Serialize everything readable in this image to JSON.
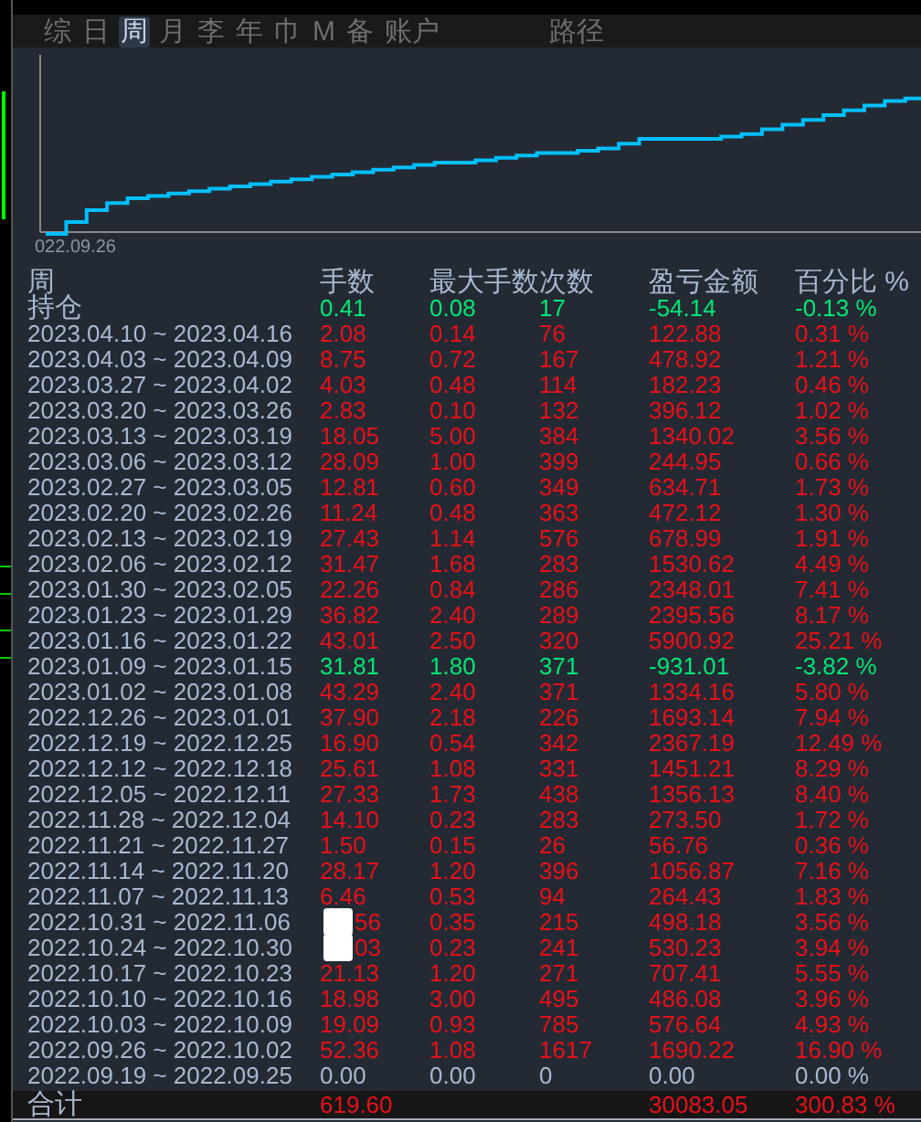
{
  "tabs": [
    {
      "label": "综",
      "selected": false
    },
    {
      "label": "日",
      "selected": false
    },
    {
      "label": "周",
      "selected": true
    },
    {
      "label": "月",
      "selected": false
    },
    {
      "label": "李",
      "selected": false
    },
    {
      "label": "年",
      "selected": false
    },
    {
      "label": "巾",
      "selected": false
    },
    {
      "label": "M",
      "selected": false
    },
    {
      "label": "备",
      "selected": false
    },
    {
      "label": "账户",
      "selected": false
    },
    {
      "label": "路径",
      "selected": false
    }
  ],
  "chart": {
    "x_label": "022.09.26"
  },
  "table": {
    "columns": [
      "周",
      "手数",
      "最大手数",
      "次数",
      "盈亏金额",
      "百分比 %"
    ],
    "holding": {
      "cells": [
        "持仓",
        "0.41",
        "0.08",
        "17",
        "-54.14",
        "-0.13 %"
      ],
      "color": "#00e676"
    },
    "rows": [
      {
        "cells": [
          "2023.04.10 ~ 2023.04.16",
          "2.08",
          "0.14",
          "76",
          "122.88",
          "0.31 %"
        ],
        "color": "#e8101a"
      },
      {
        "cells": [
          "2023.04.03 ~ 2023.04.09",
          "8.75",
          "0.72",
          "167",
          "478.92",
          "1.21 %"
        ],
        "color": "#e8101a"
      },
      {
        "cells": [
          "2023.03.27 ~ 2023.04.02",
          "4.03",
          "0.48",
          "114",
          "182.23",
          "0.46 %"
        ],
        "color": "#e8101a"
      },
      {
        "cells": [
          "2023.03.20 ~ 2023.03.26",
          "2.83",
          "0.10",
          "132",
          "396.12",
          "1.02 %"
        ],
        "color": "#e8101a"
      },
      {
        "cells": [
          "2023.03.13 ~ 2023.03.19",
          "18.05",
          "5.00",
          "384",
          "1340.02",
          "3.56 %"
        ],
        "color": "#e8101a"
      },
      {
        "cells": [
          "2023.03.06 ~ 2023.03.12",
          "28.09",
          "1.00",
          "399",
          "244.95",
          "0.66 %"
        ],
        "color": "#e8101a"
      },
      {
        "cells": [
          "2023.02.27 ~ 2023.03.05",
          "12.81",
          "0.60",
          "349",
          "634.71",
          "1.73 %"
        ],
        "color": "#e8101a"
      },
      {
        "cells": [
          "2023.02.20 ~ 2023.02.26",
          "11.24",
          "0.48",
          "363",
          "472.12",
          "1.30 %"
        ],
        "color": "#e8101a"
      },
      {
        "cells": [
          "2023.02.13 ~ 2023.02.19",
          "27.43",
          "1.14",
          "576",
          "678.99",
          "1.91 %"
        ],
        "color": "#e8101a"
      },
      {
        "cells": [
          "2023.02.06 ~ 2023.02.12",
          "31.47",
          "1.68",
          "283",
          "1530.62",
          "4.49 %"
        ],
        "color": "#e8101a"
      },
      {
        "cells": [
          "2023.01.30 ~ 2023.02.05",
          "22.26",
          "0.84",
          "286",
          "2348.01",
          "7.41 %"
        ],
        "color": "#e8101a"
      },
      {
        "cells": [
          "2023.01.23 ~ 2023.01.29",
          "36.82",
          "2.40",
          "289",
          "2395.56",
          "8.17 %"
        ],
        "color": "#e8101a"
      },
      {
        "cells": [
          "2023.01.16 ~ 2023.01.22",
          "43.01",
          "2.50",
          "320",
          "5900.92",
          "25.21 %"
        ],
        "color": "#e8101a"
      },
      {
        "cells": [
          "2023.01.09 ~ 2023.01.15",
          "31.81",
          "1.80",
          "371",
          "-931.01",
          "-3.82 %"
        ],
        "color": "#00e676"
      },
      {
        "cells": [
          "2023.01.02 ~ 2023.01.08",
          "43.29",
          "2.40",
          "371",
          "1334.16",
          "5.80 %"
        ],
        "color": "#e8101a"
      },
      {
        "cells": [
          "2022.12.26 ~ 2023.01.01",
          "37.90",
          "2.18",
          "226",
          "1693.14",
          "7.94 %"
        ],
        "color": "#e8101a"
      },
      {
        "cells": [
          "2022.12.19 ~ 2022.12.25",
          "16.90",
          "0.54",
          "342",
          "2367.19",
          "12.49 %"
        ],
        "color": "#e8101a"
      },
      {
        "cells": [
          "2022.12.12 ~ 2022.12.18",
          "25.61",
          "1.08",
          "331",
          "1451.21",
          "8.29 %"
        ],
        "color": "#e8101a"
      },
      {
        "cells": [
          "2022.12.05 ~ 2022.12.11",
          "27.33",
          "1.73",
          "438",
          "1356.13",
          "8.40 %"
        ],
        "color": "#e8101a"
      },
      {
        "cells": [
          "2022.11.28 ~ 2022.12.04",
          "14.10",
          "0.23",
          "283",
          "273.50",
          "1.72 %"
        ],
        "color": "#e8101a"
      },
      {
        "cells": [
          "2022.11.21 ~ 2022.11.27",
          "1.50",
          "0.15",
          "26",
          "56.76",
          "0.36 %"
        ],
        "color": "#e8101a"
      },
      {
        "cells": [
          "2022.11.14 ~ 2022.11.20",
          "28.17",
          "1.20",
          "396",
          "1056.87",
          "7.16 %"
        ],
        "color": "#e8101a"
      },
      {
        "cells": [
          "2022.11.07 ~ 2022.11.13",
          "6.46",
          "0.53",
          "94",
          "264.43",
          "1.83 %"
        ],
        "color": "#e8101a"
      },
      {
        "cells": [
          "2022.10.31 ~ 2022.11.06",
          "56",
          "0.35",
          "215",
          "498.18",
          "3.56 %"
        ],
        "color": "#e8101a",
        "kind": "obscured"
      },
      {
        "cells": [
          "2022.10.24 ~ 2022.10.30",
          "03",
          "0.23",
          "241",
          "530.23",
          "3.94 %"
        ],
        "color": "#e8101a",
        "kind": "obscured"
      },
      {
        "cells": [
          "2022.10.17 ~ 2022.10.23",
          "21.13",
          "1.20",
          "271",
          "707.41",
          "5.55 %"
        ],
        "color": "#e8101a"
      },
      {
        "cells": [
          "2022.10.10 ~ 2022.10.16",
          "18.98",
          "3.00",
          "495",
          "486.08",
          "3.96 %"
        ],
        "color": "#e8101a"
      },
      {
        "cells": [
          "2022.10.03 ~ 2022.10.09",
          "19.09",
          "0.93",
          "785",
          "576.64",
          "4.93 %"
        ],
        "color": "#e8101a"
      },
      {
        "cells": [
          "2022.09.26 ~ 2022.10.02",
          "52.36",
          "1.08",
          "1617",
          "1690.22",
          "16.90 %"
        ],
        "color": "#e8101a"
      },
      {
        "cells": [
          "2022.09.19 ~ 2022.09.25",
          "0.00",
          "0.00",
          "0",
          "0.00",
          "0.00 %"
        ],
        "color": "#a9b8d0"
      }
    ],
    "total": {
      "cells": [
        "合计",
        "619.60",
        "",
        "",
        "30083.05",
        "300.83 %"
      ],
      "color": "#e8101a"
    }
  }
}
